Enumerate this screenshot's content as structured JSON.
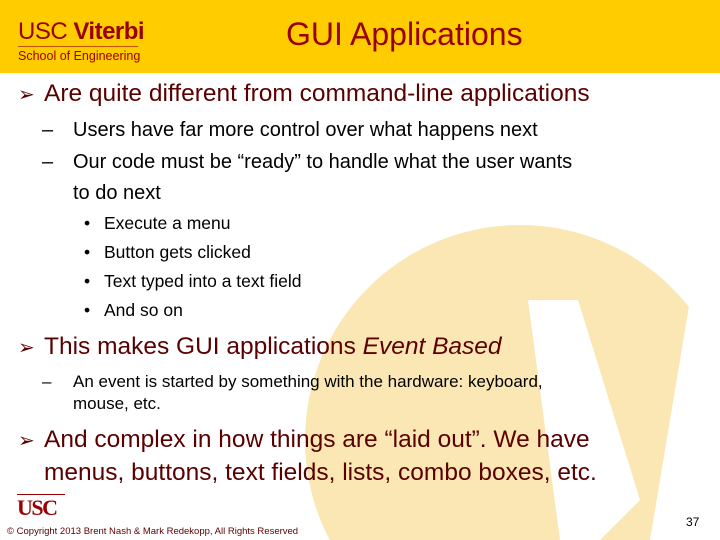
{
  "header": {
    "logo_usc": "USC",
    "logo_viterbi": "Viterbi",
    "logo_school": "School of Engineering",
    "title": "GUI Applications"
  },
  "icons": {
    "bullet_l1": "arrow-bullet-icon",
    "bullet_l2": "dash",
    "bullet_l3": "dot"
  },
  "glyphs": {
    "arrow": "➢",
    "dash": "–",
    "dot": "•"
  },
  "content": {
    "point1": {
      "text": "Are quite different from command-line applications",
      "sub": [
        {
          "text": "Users have far more control over what happens next"
        },
        {
          "text": "Our code must be “ready” to handle what the user wants",
          "cont": "to do next"
        }
      ],
      "items": [
        "Execute a menu",
        "Button gets clicked",
        "Text typed into a text field",
        "And so on"
      ]
    },
    "point2": {
      "text": "This makes GUI applications ",
      "emphasis": "Event Based",
      "sub": [
        {
          "text": "An event is started by something with the hardware: keyboard,",
          "cont": "mouse, etc."
        }
      ]
    },
    "point3": {
      "text": "And complex in how things are “laid out”. We have",
      "cont": "menus, buttons, text fields, lists, combo boxes, etc."
    }
  },
  "footer": {
    "logo": "USC",
    "copyright": "© Copyright 2013 Brent Nash & Mark Redekopp, All Rights Reserved",
    "page_number": "37"
  },
  "colors": {
    "header_bg": "#ffcc00",
    "cardinal": "#990000",
    "heading_text": "#5a0000",
    "watermark": "#fbe7b4"
  }
}
